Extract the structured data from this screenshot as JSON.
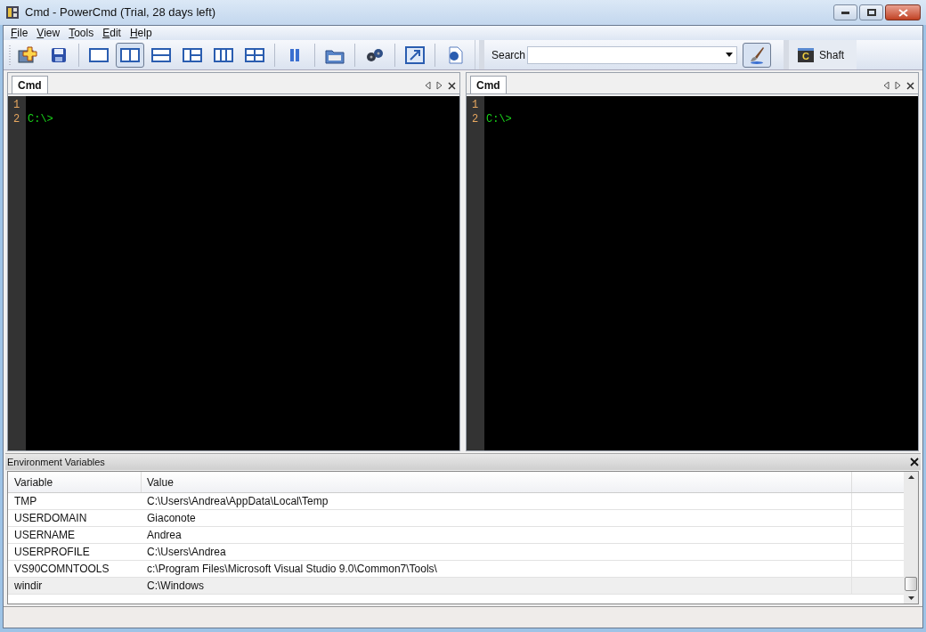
{
  "window": {
    "title": "Cmd - PowerCmd (Trial, 28 days left)"
  },
  "menu": [
    {
      "key": "F",
      "rest": "ile"
    },
    {
      "key": "V",
      "rest": "iew"
    },
    {
      "key": "T",
      "rest": "ools"
    },
    {
      "key": "E",
      "rest": "dit"
    },
    {
      "key": "H",
      "rest": "elp"
    }
  ],
  "toolbar": [
    {
      "kind": "new",
      "selected": false
    },
    {
      "kind": "save",
      "selected": false
    },
    {
      "kind": "sep"
    },
    {
      "kind": "single",
      "selected": false
    },
    {
      "kind": "cols2",
      "selected": true
    },
    {
      "kind": "rows2",
      "selected": false
    },
    {
      "kind": "mixed",
      "selected": false
    },
    {
      "kind": "cols3",
      "selected": false
    },
    {
      "kind": "grid",
      "selected": false
    },
    {
      "kind": "sep"
    },
    {
      "kind": "pause",
      "selected": false
    },
    {
      "kind": "sep"
    },
    {
      "kind": "log",
      "selected": false
    },
    {
      "kind": "sep"
    },
    {
      "kind": "gears",
      "selected": false
    },
    {
      "kind": "sep"
    },
    {
      "kind": "external",
      "selected": false
    },
    {
      "kind": "sep"
    },
    {
      "kind": "help",
      "selected": false
    }
  ],
  "search": {
    "label": "Search"
  },
  "shaft": {
    "icon": "C",
    "label": "Shaft"
  },
  "panes": [
    {
      "tab": "Cmd",
      "lines": [
        {
          "number": "1"
        },
        {
          "number": "2",
          "text": "C:\\>"
        }
      ]
    },
    {
      "tab": "Cmd",
      "lines": [
        {
          "number": "1"
        },
        {
          "number": "2",
          "text": "C:\\>"
        }
      ]
    }
  ],
  "env_panel": {
    "title": "Environment Variables",
    "columns": [
      "Variable",
      "Value"
    ],
    "rows": [
      {
        "variable": "TMP",
        "value": "C:\\Users\\Andrea\\AppData\\Local\\Temp",
        "selected": false
      },
      {
        "variable": "USERDOMAIN",
        "value": "Giaconote",
        "selected": false
      },
      {
        "variable": "USERNAME",
        "value": "Andrea",
        "selected": false
      },
      {
        "variable": "USERPROFILE",
        "value": "C:\\Users\\Andrea",
        "selected": false
      },
      {
        "variable": "VS90COMNTOOLS",
        "value": "c:\\Program Files\\Microsoft Visual Studio 9.0\\Common7\\Tools\\",
        "selected": false
      },
      {
        "variable": "windir",
        "value": "C:\\Windows",
        "selected": true
      }
    ]
  }
}
